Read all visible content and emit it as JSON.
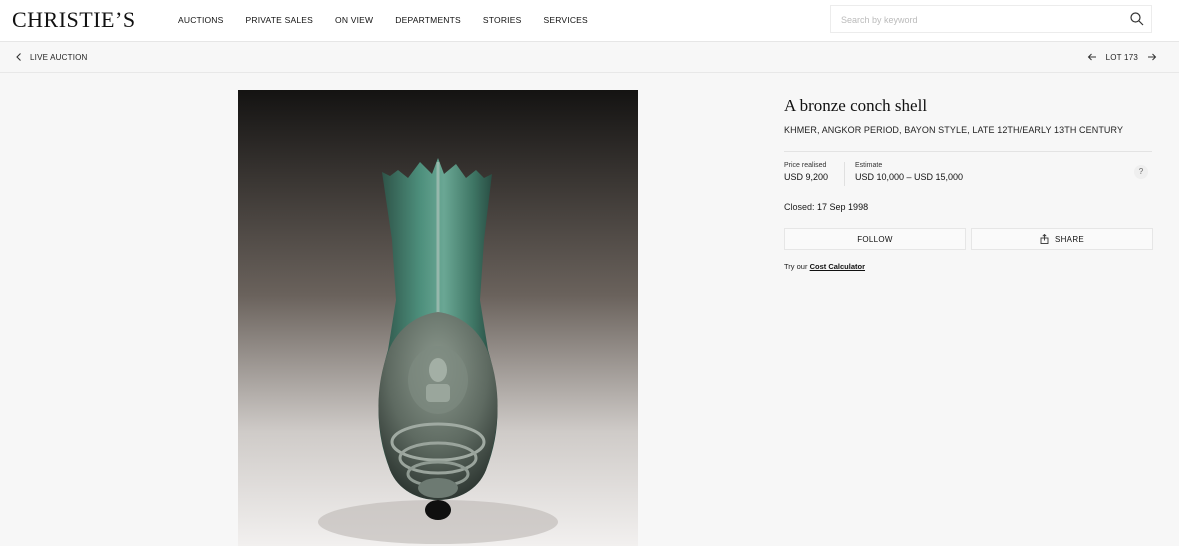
{
  "brand": {
    "logo": "CHRISTIE’S"
  },
  "nav": {
    "items": [
      {
        "label": "AUCTIONS"
      },
      {
        "label": "PRIVATE SALES"
      },
      {
        "label": "ON VIEW"
      },
      {
        "label": "DEPARTMENTS"
      },
      {
        "label": "STORIES"
      },
      {
        "label": "SERVICES"
      }
    ]
  },
  "search": {
    "placeholder": "Search by keyword",
    "icon": "search-icon"
  },
  "subbar": {
    "back_label": "LIVE AUCTION",
    "lot_label": "LOT 173"
  },
  "lot": {
    "title": "A bronze conch shell",
    "subtitle": "KHMER, ANGKOR PERIOD, BAYON STYLE, LATE 12TH/EARLY 13TH CENTURY",
    "price_realised_label": "Price realised",
    "price_realised_value": "USD 9,200",
    "estimate_label": "Estimate",
    "estimate_value": "USD 10,000 – USD 15,000",
    "help": "?",
    "closed_label": "Closed:",
    "closed_date": "17 Sep 1998",
    "follow_label": "FOLLOW",
    "share_label": "SHARE",
    "calc_prefix": "Try our",
    "calc_link": "Cost Calculator"
  },
  "colors": {
    "background": "#f7f7f7",
    "header": "#ffffff",
    "text": "#222222",
    "bronze_patina": "#3f7d6c"
  }
}
